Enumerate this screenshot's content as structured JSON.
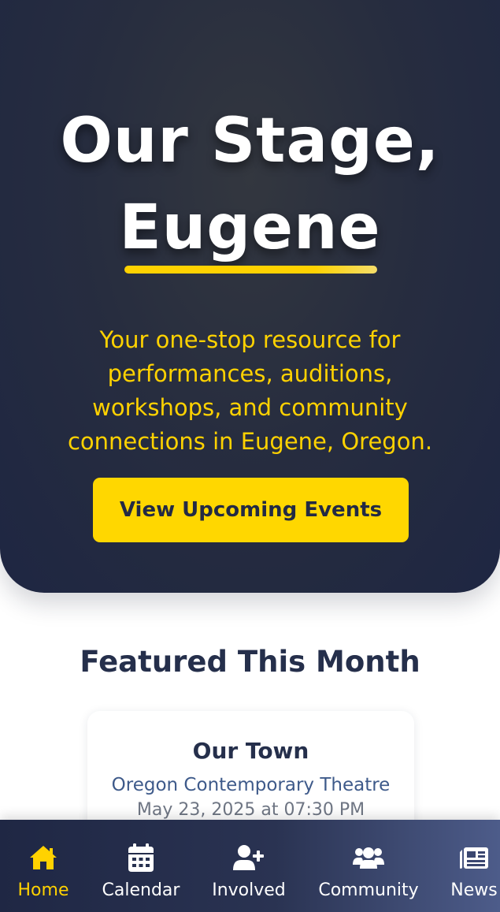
{
  "hero": {
    "title_line1": "Our Stage,",
    "title_line2": "Eugene",
    "subtitle": "Your one-stop resource for performances, auditions, workshops, and community connections in Eugene, Oregon.",
    "cta_label": "View Upcoming Events"
  },
  "featured": {
    "heading": "Featured This Month",
    "card": {
      "title": "Our Town",
      "venue": "Oregon Contemporary Theatre",
      "date": "May 23, 2025 at 07:30 PM"
    }
  },
  "nav": {
    "items": [
      {
        "label": "Home",
        "icon": "home-icon",
        "active": true
      },
      {
        "label": "Calendar",
        "icon": "calendar-icon",
        "active": false
      },
      {
        "label": "Involved",
        "icon": "user-plus-icon",
        "active": false
      },
      {
        "label": "Community",
        "icon": "users-icon",
        "active": false
      },
      {
        "label": "News",
        "icon": "newspaper-icon",
        "active": false
      }
    ]
  },
  "colors": {
    "accent": "#ffd200",
    "hero_bg": "#272d3f",
    "heading_text": "#252f4b",
    "nav_bg": "#1f2744"
  }
}
